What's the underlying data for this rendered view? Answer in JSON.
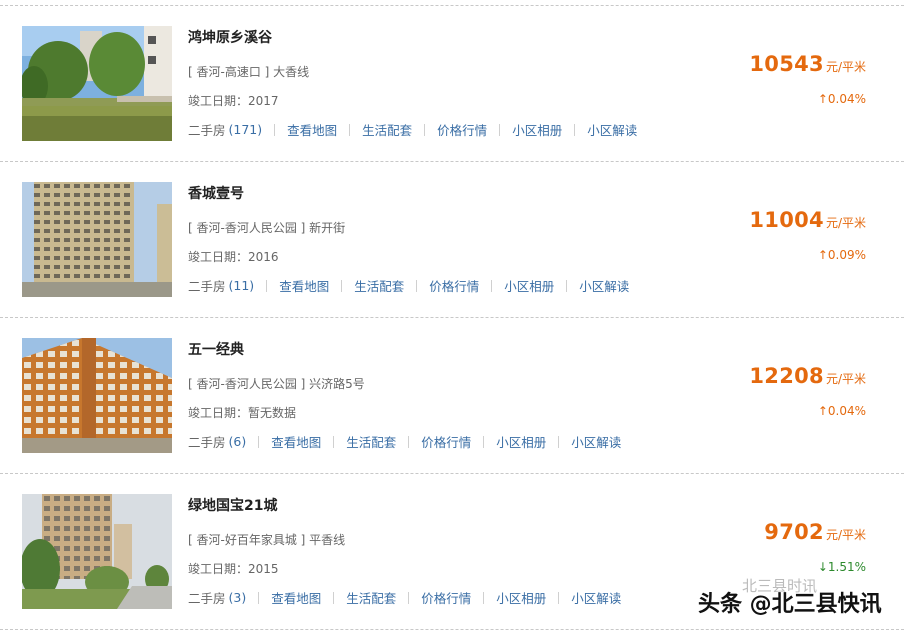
{
  "listings": [
    {
      "name": "鸿坤原乡溪谷",
      "address": "[ 香河-高速口 ] 大香线",
      "year": "竣工日期：2017",
      "secondhand_label": "二手房",
      "secondhand_count": "(171)",
      "links": [
        "查看地图",
        "生活配套",
        "价格行情",
        "小区相册",
        "小区解读"
      ],
      "price": "10543",
      "unit": "元/平米",
      "change": "↑0.04%",
      "trend": "up"
    },
    {
      "name": "香城壹号",
      "address": "[ 香河-香河人民公园 ] 新开街",
      "year": "竣工日期：2016",
      "secondhand_label": "二手房",
      "secondhand_count": "(11)",
      "links": [
        "查看地图",
        "生活配套",
        "价格行情",
        "小区相册",
        "小区解读"
      ],
      "price": "11004",
      "unit": "元/平米",
      "change": "↑0.09%",
      "trend": "up"
    },
    {
      "name": "五一经典",
      "address": "[ 香河-香河人民公园 ] 兴济路5号",
      "year": "竣工日期：暂无数据",
      "secondhand_label": "二手房",
      "secondhand_count": "(6)",
      "links": [
        "查看地图",
        "生活配套",
        "价格行情",
        "小区相册",
        "小区解读"
      ],
      "price": "12208",
      "unit": "元/平米",
      "change": "↑0.04%",
      "trend": "up"
    },
    {
      "name": "绿地国宝21城",
      "address": "[ 香河-好百年家具城 ] 平香线",
      "year": "竣工日期：2015",
      "secondhand_label": "二手房",
      "secondhand_count": "(3)",
      "links": [
        "查看地图",
        "生活配套",
        "价格行情",
        "小区相册",
        "小区解读"
      ],
      "price": "9702",
      "unit": "元/平米",
      "change": "↓1.51%",
      "trend": "down"
    }
  ],
  "watermark": {
    "main": "头条 @北三县快讯",
    "faint": "北三县时讯"
  },
  "colors": {
    "price": "#e4690e",
    "link": "#3a6ea5",
    "down": "#2d8a2d"
  }
}
